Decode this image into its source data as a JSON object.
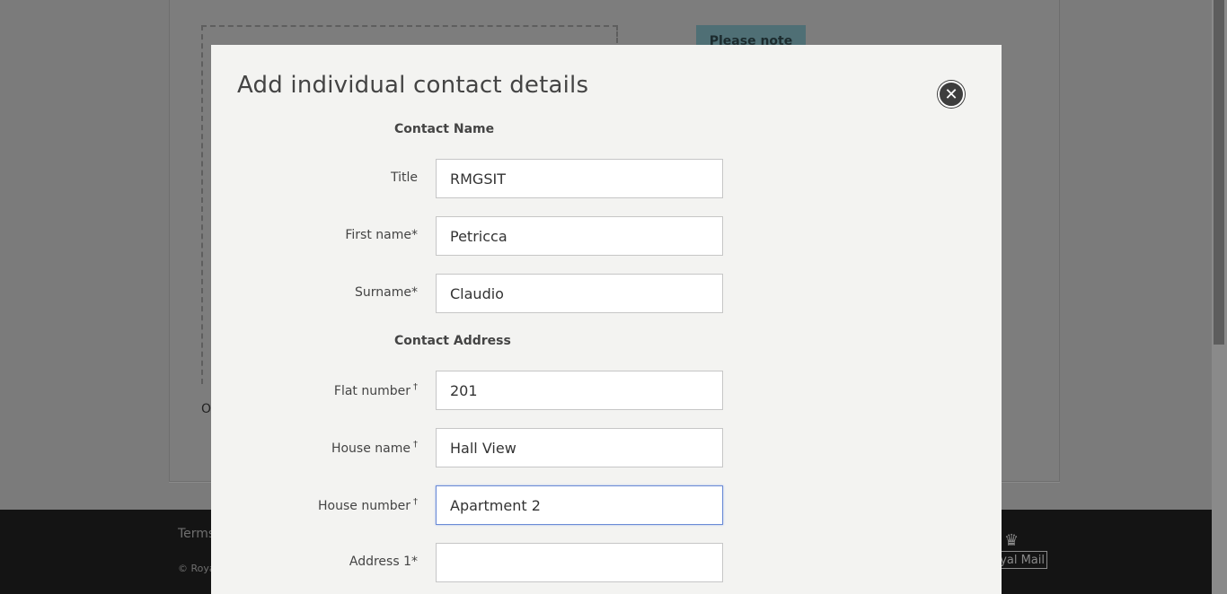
{
  "background": {
    "note_label": "Please note",
    "partial_text": "O",
    "footer_terms": "Terms",
    "footer_copyright": "© Roya",
    "logo_text": "yal Mail"
  },
  "modal": {
    "title": "Add individual contact details",
    "close_icon": "close-icon",
    "sections": {
      "contact_name": "Contact Name",
      "contact_address": "Contact Address"
    },
    "fields": {
      "title": {
        "label": "Title",
        "value": "RMGSIT"
      },
      "first_name": {
        "label": "First name*",
        "value": "Petricca"
      },
      "surname": {
        "label": "Surname*",
        "value": "Claudio"
      },
      "flat_number": {
        "label": "Flat number",
        "marker": "†",
        "value": "201"
      },
      "house_name": {
        "label": "House name",
        "marker": "†",
        "value": "Hall View"
      },
      "house_number": {
        "label": "House number",
        "marker": "†",
        "value": "Apartment 2"
      },
      "address_1": {
        "label": "Address 1*",
        "value": ""
      }
    }
  }
}
